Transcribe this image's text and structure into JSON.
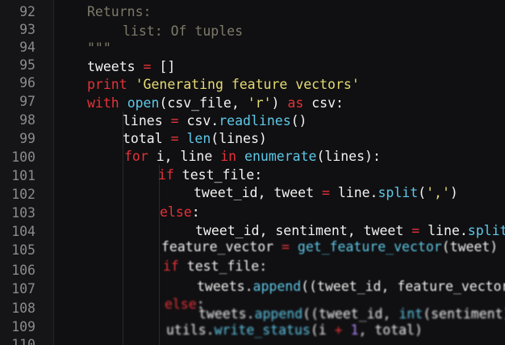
{
  "editor": {
    "language": "python",
    "colors": {
      "background": "#101012",
      "gutter": "#151517",
      "line_number": "#8b8b8b",
      "comment": "#7d7a6a",
      "keyword": "#e63238",
      "string": "#e6db74",
      "builtin": "#5ec8e8",
      "plain": "#f2f2f2",
      "number": "#b48cff"
    },
    "lines": [
      {
        "num": "92",
        "tokens": [
          {
            "t": "Returns:",
            "c": "comment"
          }
        ]
      },
      {
        "num": "93",
        "tokens": [
          {
            "t": "list: Of tuples",
            "c": "comment"
          }
        ]
      },
      {
        "num": "94",
        "tokens": [
          {
            "t": "\"\"\"",
            "c": "comment"
          }
        ]
      },
      {
        "num": "95",
        "tokens": [
          {
            "t": "tweets ",
            "c": "plain"
          },
          {
            "t": "=",
            "c": "op"
          },
          {
            "t": " []",
            "c": "plain"
          }
        ]
      },
      {
        "num": "96",
        "tokens": [
          {
            "t": "print",
            "c": "kw"
          },
          {
            "t": " ",
            "c": "plain"
          },
          {
            "t": "'Generating feature vectors'",
            "c": "str"
          }
        ]
      },
      {
        "num": "97",
        "tokens": [
          {
            "t": "with",
            "c": "kw"
          },
          {
            "t": " ",
            "c": "plain"
          },
          {
            "t": "open",
            "c": "builtin"
          },
          {
            "t": "(csv_file, ",
            "c": "plain"
          },
          {
            "t": "'r'",
            "c": "str"
          },
          {
            "t": ") ",
            "c": "plain"
          },
          {
            "t": "as",
            "c": "kw"
          },
          {
            "t": " csv:",
            "c": "plain"
          }
        ]
      },
      {
        "num": "98",
        "tokens": [
          {
            "t": "lines ",
            "c": "plain"
          },
          {
            "t": "=",
            "c": "op"
          },
          {
            "t": " csv.",
            "c": "plain"
          },
          {
            "t": "readlines",
            "c": "builtin"
          },
          {
            "t": "()",
            "c": "plain"
          }
        ]
      },
      {
        "num": "99",
        "tokens": [
          {
            "t": "total ",
            "c": "plain"
          },
          {
            "t": "=",
            "c": "op"
          },
          {
            "t": " ",
            "c": "plain"
          },
          {
            "t": "len",
            "c": "builtin"
          },
          {
            "t": "(lines)",
            "c": "plain"
          }
        ]
      },
      {
        "num": "100",
        "tokens": [
          {
            "t": "for",
            "c": "kw"
          },
          {
            "t": " i, line ",
            "c": "plain"
          },
          {
            "t": "in",
            "c": "kw"
          },
          {
            "t": " ",
            "c": "plain"
          },
          {
            "t": "enumerate",
            "c": "builtin"
          },
          {
            "t": "(lines):",
            "c": "plain"
          }
        ]
      },
      {
        "num": "101",
        "tokens": [
          {
            "t": "if",
            "c": "kw"
          },
          {
            "t": " test_file:",
            "c": "plain"
          }
        ]
      },
      {
        "num": "102",
        "tokens": [
          {
            "t": "tweet_id, tweet ",
            "c": "plain"
          },
          {
            "t": "=",
            "c": "op"
          },
          {
            "t": " line.",
            "c": "plain"
          },
          {
            "t": "split",
            "c": "builtin"
          },
          {
            "t": "(",
            "c": "plain"
          },
          {
            "t": "','",
            "c": "str"
          },
          {
            "t": ")",
            "c": "plain"
          }
        ]
      },
      {
        "num": "103",
        "tokens": [
          {
            "t": "else",
            "c": "kw"
          },
          {
            "t": ":",
            "c": "plain"
          }
        ]
      },
      {
        "num": "104",
        "tokens": [
          {
            "t": "tweet_id, sentiment, tweet ",
            "c": "plain"
          },
          {
            "t": "=",
            "c": "op"
          },
          {
            "t": " line.",
            "c": "plain"
          },
          {
            "t": "split",
            "c": "builtin"
          },
          {
            "t": "(','",
            "c": "plain"
          }
        ]
      },
      {
        "num": "105",
        "tokens": [
          {
            "t": "feature_vector ",
            "c": "plain"
          },
          {
            "t": "=",
            "c": "op"
          },
          {
            "t": " ",
            "c": "plain"
          },
          {
            "t": "get_feature_vector",
            "c": "builtin"
          },
          {
            "t": "(tweet)",
            "c": "plain"
          }
        ]
      },
      {
        "num": "106",
        "tokens": [
          {
            "t": "if",
            "c": "kw"
          },
          {
            "t": " test_file:",
            "c": "plain"
          }
        ]
      },
      {
        "num": "107",
        "tokens": [
          {
            "t": "tweets.",
            "c": "plain"
          },
          {
            "t": "append",
            "c": "builtin"
          },
          {
            "t": "((tweet_id, feature_vector)",
            "c": "plain"
          }
        ]
      },
      {
        "num": "108",
        "tokens": [
          {
            "t": "else",
            "c": "kw"
          },
          {
            "t": ":",
            "c": "plain"
          }
        ]
      },
      {
        "num": "109",
        "tokens": [
          {
            "t": "tweets.",
            "c": "plain"
          },
          {
            "t": "append",
            "c": "builtin"
          },
          {
            "t": "((tweet_id, ",
            "c": "plain"
          },
          {
            "t": "int",
            "c": "builtin"
          },
          {
            "t": "(sentiment),",
            "c": "plain"
          }
        ]
      },
      {
        "num": "110",
        "tokens": [
          {
            "t": "utils.",
            "c": "plain"
          },
          {
            "t": "write_status",
            "c": "builtin"
          },
          {
            "t": "(i ",
            "c": "plain"
          },
          {
            "t": "+",
            "c": "op"
          },
          {
            "t": " ",
            "c": "plain"
          },
          {
            "t": "1",
            "c": "num"
          },
          {
            "t": ", total)",
            "c": "plain"
          }
        ]
      }
    ]
  }
}
